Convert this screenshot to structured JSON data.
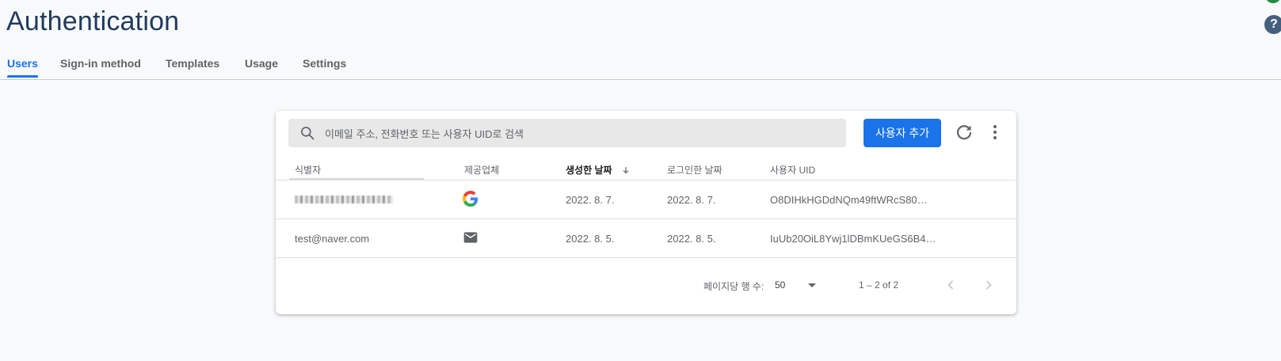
{
  "header": {
    "title": "Authentication"
  },
  "tabs": [
    {
      "label": "Users",
      "active": true
    },
    {
      "label": "Sign-in method"
    },
    {
      "label": "Templates"
    },
    {
      "label": "Usage"
    },
    {
      "label": "Settings"
    }
  ],
  "toolbar": {
    "search_placeholder": "이메일 주소, 전화번호 또는 사용자 UID로 검색",
    "add_user_label": "사용자 추가"
  },
  "table": {
    "columns": [
      "식별자",
      "제공업체",
      "생성한 날짜",
      "로그인한 날짜",
      "사용자 UID"
    ],
    "sorted_column": "생성한 날짜",
    "rows": [
      {
        "identifier": "",
        "provider": "google-icon",
        "created": "2022. 8. 7.",
        "signed_in": "2022. 8. 7.",
        "uid": "O8DIHkHGDdNQm49ftWRcS80WF…"
      },
      {
        "identifier": "test@naver.com",
        "provider": "mail-icon",
        "created": "2022. 8. 5.",
        "signed_in": "2022. 8. 5.",
        "uid": "IuUb20OiL8Ywj1lDBmKUeGS6B4b2"
      }
    ]
  },
  "pagination": {
    "rows_per_page_label": "페이지당 행 수:",
    "rows_per_page_value": "50",
    "range": "1 – 2 of 2"
  },
  "colors": {
    "accent": "#1a73e8",
    "title": "#1f3a5c",
    "help": "#44607f"
  },
  "icons": [
    "search-icon",
    "refresh-icon",
    "more-vert-icon",
    "google-icon",
    "mail-icon",
    "chevron-left-icon",
    "chevron-right-icon",
    "sort-down-icon",
    "help-icon"
  ]
}
